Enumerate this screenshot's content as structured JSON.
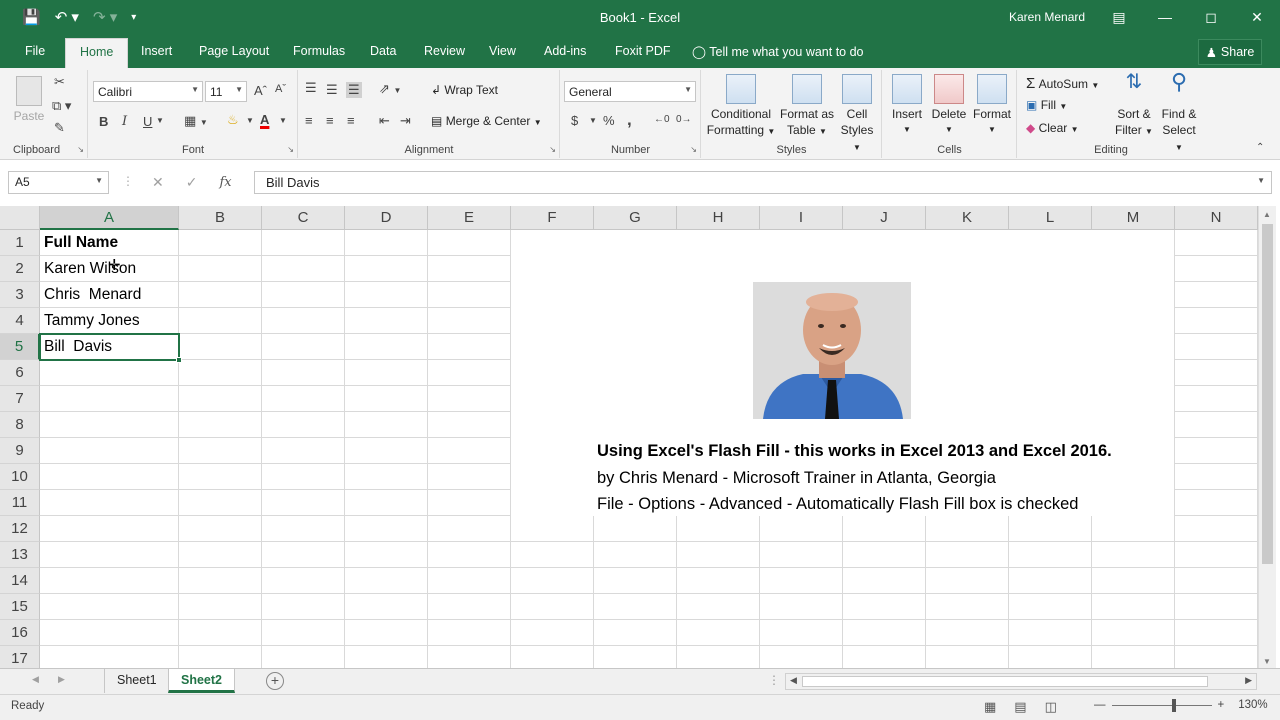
{
  "window": {
    "title": "Book1 - Excel",
    "user": "Karen Menard",
    "qat": [
      "save-icon",
      "undo-icon",
      "redo-icon",
      "customize-qat-icon"
    ]
  },
  "tabs": {
    "items": [
      "File",
      "Home",
      "Insert",
      "Page Layout",
      "Formulas",
      "Data",
      "Review",
      "View",
      "Add-ins",
      "Foxit PDF"
    ],
    "active": "Home",
    "tell_me": "Tell me what you want to do",
    "share": "Share"
  },
  "ribbon": {
    "clipboard": {
      "label": "Clipboard",
      "paste": "Paste"
    },
    "font": {
      "label": "Font",
      "name": "Calibri",
      "size": "11",
      "bold": "B",
      "italic": "I",
      "underline": "U"
    },
    "alignment": {
      "label": "Alignment",
      "wrap_text": "Wrap Text",
      "merge_center": "Merge & Center"
    },
    "number": {
      "label": "Number",
      "format": "General",
      "currency": "$",
      "percent": "%",
      "comma": ","
    },
    "styles": {
      "label": "Styles",
      "conditional_1": "Conditional",
      "conditional_2": "Formatting",
      "format_table_1": "Format as",
      "format_table_2": "Table",
      "cell_styles_1": "Cell",
      "cell_styles_2": "Styles"
    },
    "cells": {
      "label": "Cells",
      "insert": "Insert",
      "delete": "Delete",
      "format": "Format"
    },
    "editing": {
      "label": "Editing",
      "autosum": "AutoSum",
      "fill": "Fill",
      "clear": "Clear",
      "sort_1": "Sort &",
      "sort_2": "Filter",
      "find_1": "Find &",
      "find_2": "Select"
    }
  },
  "formula_bar": {
    "name_box": "A5",
    "fx": "fx",
    "content": "Bill  Davis"
  },
  "grid": {
    "columns": [
      "A",
      "B",
      "C",
      "D",
      "E",
      "F",
      "G",
      "H",
      "I",
      "J",
      "K",
      "L",
      "M",
      "N"
    ],
    "selected_column": "A",
    "rows": [
      "1",
      "2",
      "3",
      "4",
      "5",
      "6",
      "7",
      "8",
      "9",
      "10",
      "11",
      "12",
      "13",
      "14",
      "15",
      "16",
      "17"
    ],
    "selected_row": "5",
    "cells": [
      "Full Name",
      "Karen Wilson",
      "Chris  Menard",
      "Tammy Jones",
      "Bill  Davis"
    ]
  },
  "textbox": {
    "line1": "Using Excel's Flash Fill - this works in Excel 2013 and Excel 2016.",
    "line2": "by Chris Menard - Microsoft Trainer in Atlanta, Georgia",
    "line3": "File - Options - Advanced - Automatically Flash Fill box is checked"
  },
  "sheets": {
    "tabs": [
      "Sheet1",
      "Sheet2"
    ],
    "active": "Sheet2",
    "add": "+"
  },
  "status": {
    "ready": "Ready",
    "zoom": "130%",
    "zoom_fraction": 0.62
  }
}
